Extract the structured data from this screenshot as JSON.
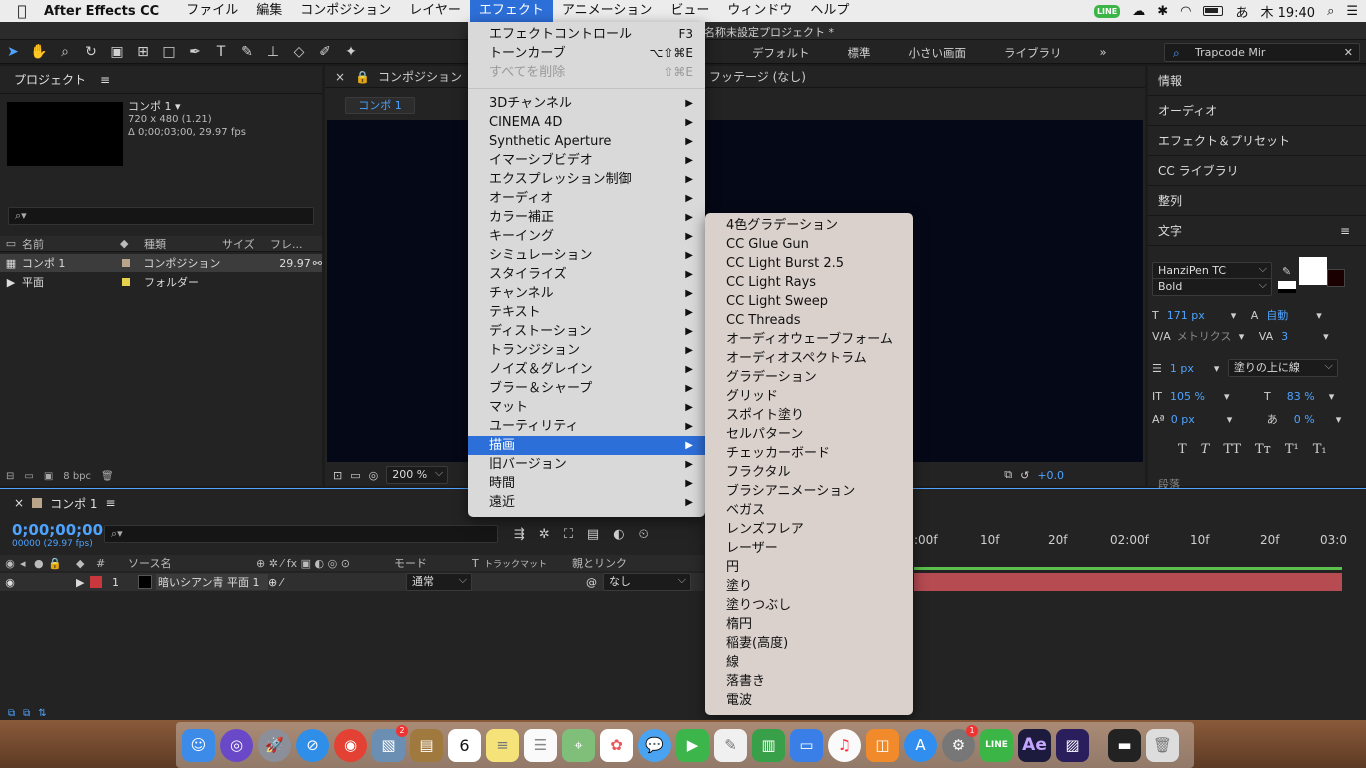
{
  "menubar": {
    "app_name": "After Effects CC",
    "items": [
      "ファイル",
      "編集",
      "コンポジション",
      "レイヤー",
      "エフェクト",
      "アニメーション",
      "ビュー",
      "ウィンドウ",
      "ヘルプ"
    ],
    "active_item": "エフェクト",
    "line_badge": "LINE",
    "ime": "あ",
    "clock": "木 19:40"
  },
  "window": {
    "title": "名称未設定プロジェクト *"
  },
  "toolbar": {
    "workspaces": [
      "デフォルト",
      "標準",
      "小さい画面",
      "ライブラリ"
    ],
    "overflow": "»",
    "search_value": "Trapcode Mir"
  },
  "project": {
    "title": "プロジェクト",
    "comp_name": "コンポ 1 ▾",
    "comp_size": "720 x 480 (1.21)",
    "comp_duration": "Δ 0;00;03;00, 29.97 fps",
    "search_placeholder": "⌕▾",
    "columns": [
      "名前",
      "種類",
      "サイズ",
      "フレ..."
    ],
    "rows": [
      {
        "name": "コンポ 1",
        "type": "コンポジション",
        "frames": "29.97",
        "color": "#b9a68a"
      },
      {
        "name": "平面",
        "type": "フォルダー",
        "frames": "",
        "color": "#e7d14c"
      }
    ],
    "bpc": "8 bpc"
  },
  "viewer": {
    "tab_label": "コンポジション",
    "footage_label": "フッテージ (なし)",
    "comp_chip": "コンポ 1",
    "zoom": "200 %",
    "exposure": "+0.0"
  },
  "right_panel": {
    "items": [
      "情報",
      "オーディオ",
      "エフェクト＆プリセット",
      "CC ライブラリ",
      "整列"
    ],
    "character": {
      "title": "文字",
      "font_family": "HanziPen TC",
      "font_style": "Bold",
      "font_size": "171 px",
      "leading": "自動",
      "kerning": "メトリクス",
      "tracking": "3",
      "stroke": "1 px",
      "stroke_mode": "塗りの上に線",
      "v_scale": "105 %",
      "h_scale": "83 %",
      "baseline": "0 px",
      "tsume": "0 %",
      "styles": [
        "T",
        "T",
        "TT",
        "Tт",
        "T¹",
        "T₁"
      ],
      "paragraph": "段落"
    }
  },
  "timeline": {
    "comp_name": "コンポ 1",
    "timecode": "0;00;00;00",
    "fps": "00000 (29.97 fps)",
    "search_placeholder": "⌕▾",
    "columns": [
      "#",
      "ソース名",
      "モード",
      "T",
      "トラックマット",
      "親とリンク"
    ],
    "layer": {
      "index": "1",
      "name": "暗いシアン青 平面 1",
      "mode": "通常",
      "parent": "なし",
      "label_color": "#c8363e"
    },
    "ruler": [
      ":00f",
      "10f",
      "20f",
      "02:00f",
      "10f",
      "20f",
      "03:0"
    ]
  },
  "effect_menu": {
    "items": [
      {
        "label": "エフェクトコントロール",
        "shortcut": "F3"
      },
      {
        "label": "トーンカーブ",
        "shortcut": "⌥⇧⌘E"
      },
      {
        "label": "すべてを削除",
        "shortcut": "⇧⌘E",
        "disabled": true
      },
      {
        "label": "3Dチャンネル",
        "submenu": true
      },
      {
        "label": "CINEMA 4D",
        "submenu": true
      },
      {
        "label": "Synthetic Aperture",
        "submenu": true
      },
      {
        "label": "イマーシブビデオ",
        "submenu": true
      },
      {
        "label": "エクスプレッション制御",
        "submenu": true
      },
      {
        "label": "オーディオ",
        "submenu": true
      },
      {
        "label": "カラー補正",
        "submenu": true
      },
      {
        "label": "キーイング",
        "submenu": true
      },
      {
        "label": "シミュレーション",
        "submenu": true
      },
      {
        "label": "スタイライズ",
        "submenu": true
      },
      {
        "label": "チャンネル",
        "submenu": true
      },
      {
        "label": "テキスト",
        "submenu": true
      },
      {
        "label": "ディストーション",
        "submenu": true
      },
      {
        "label": "トランジション",
        "submenu": true
      },
      {
        "label": "ノイズ＆グレイン",
        "submenu": true
      },
      {
        "label": "ブラー＆シャープ",
        "submenu": true
      },
      {
        "label": "マット",
        "submenu": true
      },
      {
        "label": "ユーティリティ",
        "submenu": true
      },
      {
        "label": "描画",
        "submenu": true,
        "highlighted": true
      },
      {
        "label": "旧バージョン",
        "submenu": true
      },
      {
        "label": "時間",
        "submenu": true
      },
      {
        "label": "遠近",
        "submenu": true
      }
    ],
    "arrow": "▶"
  },
  "submenu_items": [
    "4色グラデーション",
    "CC Glue Gun",
    "CC Light Burst 2.5",
    "CC Light Rays",
    "CC Light Sweep",
    "CC Threads",
    "オーディオウェーブフォーム",
    "オーディオスペクトラム",
    "グラデーション",
    "グリッド",
    "スポイト塗り",
    "セルパターン",
    "チェッカーボード",
    "フラクタル",
    "ブラシアニメーション",
    "ベガス",
    "レンズフレア",
    "レーザー",
    "円",
    "塗り",
    "塗りつぶし",
    "楕円",
    "稲妻(高度)",
    "線",
    "落書き",
    "電波"
  ],
  "dock": {
    "calendar_day": "6",
    "ae_label": "Ae",
    "badges": {
      "preview": "2",
      "prefs": "1"
    }
  }
}
